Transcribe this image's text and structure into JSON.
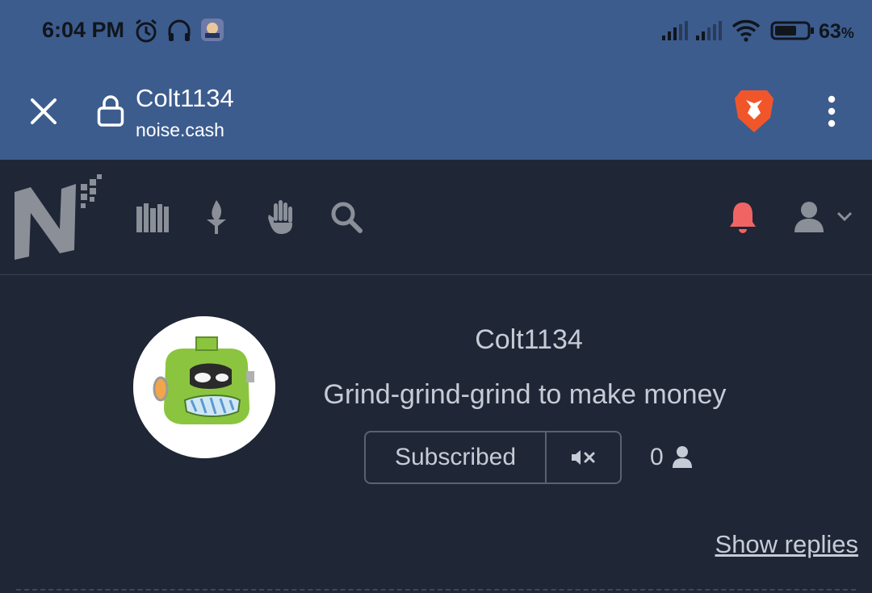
{
  "status_bar": {
    "time": "6:04 PM",
    "battery_percent": "63",
    "battery_unit": "%",
    "icons": [
      "alarm-icon",
      "headset-icon",
      "app-notification-icon",
      "signal-icon",
      "signal-icon",
      "wifi-icon",
      "battery-icon"
    ]
  },
  "browser": {
    "page_title": "Colt1134",
    "url": "noise.cash",
    "icons": [
      "close-icon",
      "lock-icon",
      "brave-lion-icon",
      "more-vert-icon"
    ]
  },
  "nav": {
    "logo": "N",
    "icons": [
      "library-icon",
      "torch-icon",
      "hand-icon",
      "search-icon",
      "bell-icon",
      "user-icon",
      "chevron-down-icon"
    ],
    "bell_color": "#f16464"
  },
  "profile": {
    "username": "Colt1134",
    "bio": "Grind-grind-grind to make money",
    "subscribe_label": "Subscribed",
    "subscriber_count": "0",
    "show_replies_label": "Show replies"
  },
  "colors": {
    "accent_bar": "#3c5c8e",
    "background": "#1f2636",
    "avatar_green": "#8bc53f"
  }
}
